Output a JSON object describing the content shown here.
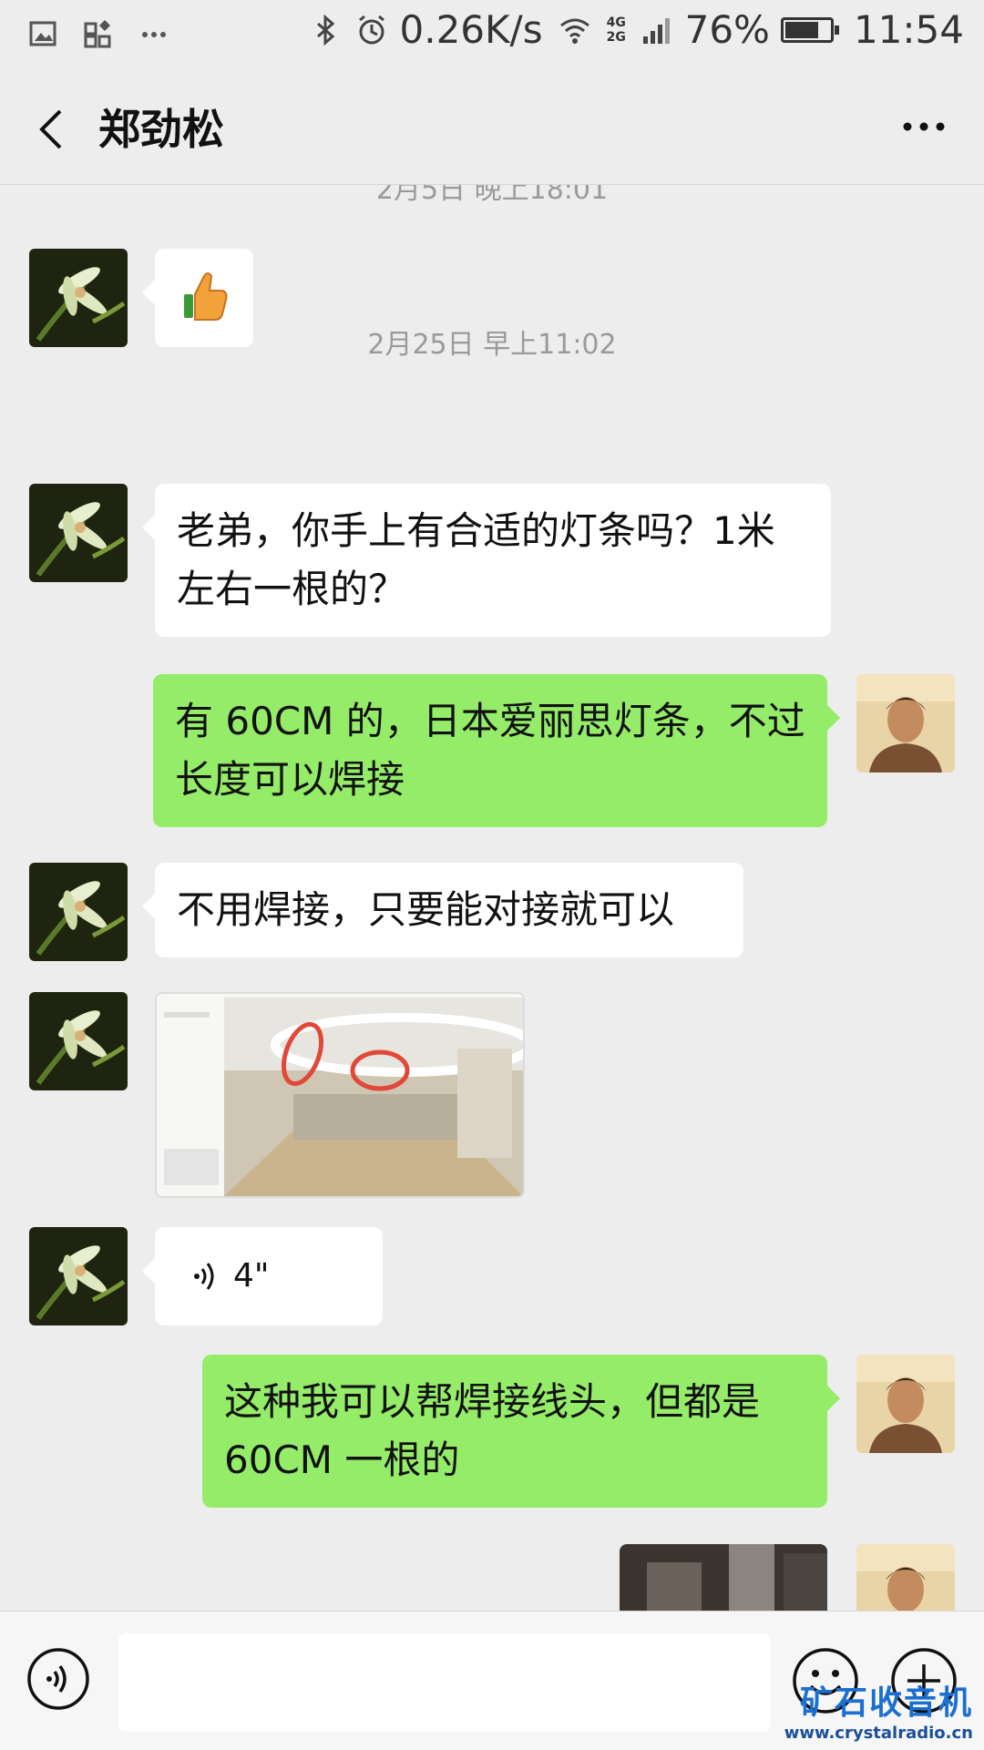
{
  "status_bar": {
    "speed": "0.26K/s",
    "network": "4G 2G",
    "battery_percent": "76%",
    "battery_level": 0.76,
    "time": "11:54"
  },
  "header": {
    "title": "郑劲松"
  },
  "chat": {
    "timestamp_top_partial": "2月5日 晚上18:01",
    "timestamp_2": "2月25日 早上11:02",
    "messages": [
      {
        "side": "in",
        "type": "emoji",
        "icon": "thumbs-up-icon"
      },
      {
        "side": "in",
        "type": "text",
        "text": "老弟，你手上有合适的灯条吗？1米左右一根的？"
      },
      {
        "side": "out",
        "type": "text",
        "text": "有 60CM 的，日本爱丽思灯条，不过长度可以焊接"
      },
      {
        "side": "in",
        "type": "text",
        "text": "不用焊接，只要能对接就可以"
      },
      {
        "side": "in",
        "type": "image",
        "icon": "photo-thumbnail"
      },
      {
        "side": "in",
        "type": "voice",
        "duration": "4\""
      },
      {
        "side": "out",
        "type": "text",
        "text": "这种我可以帮焊接线头，但都是60CM 一根的"
      },
      {
        "side": "out",
        "type": "image",
        "icon": "photo-thumbnail"
      }
    ]
  },
  "input_bar": {
    "placeholder": ""
  },
  "watermark": {
    "main": "矿石收音机",
    "url": "www.crystalradio.cn"
  }
}
